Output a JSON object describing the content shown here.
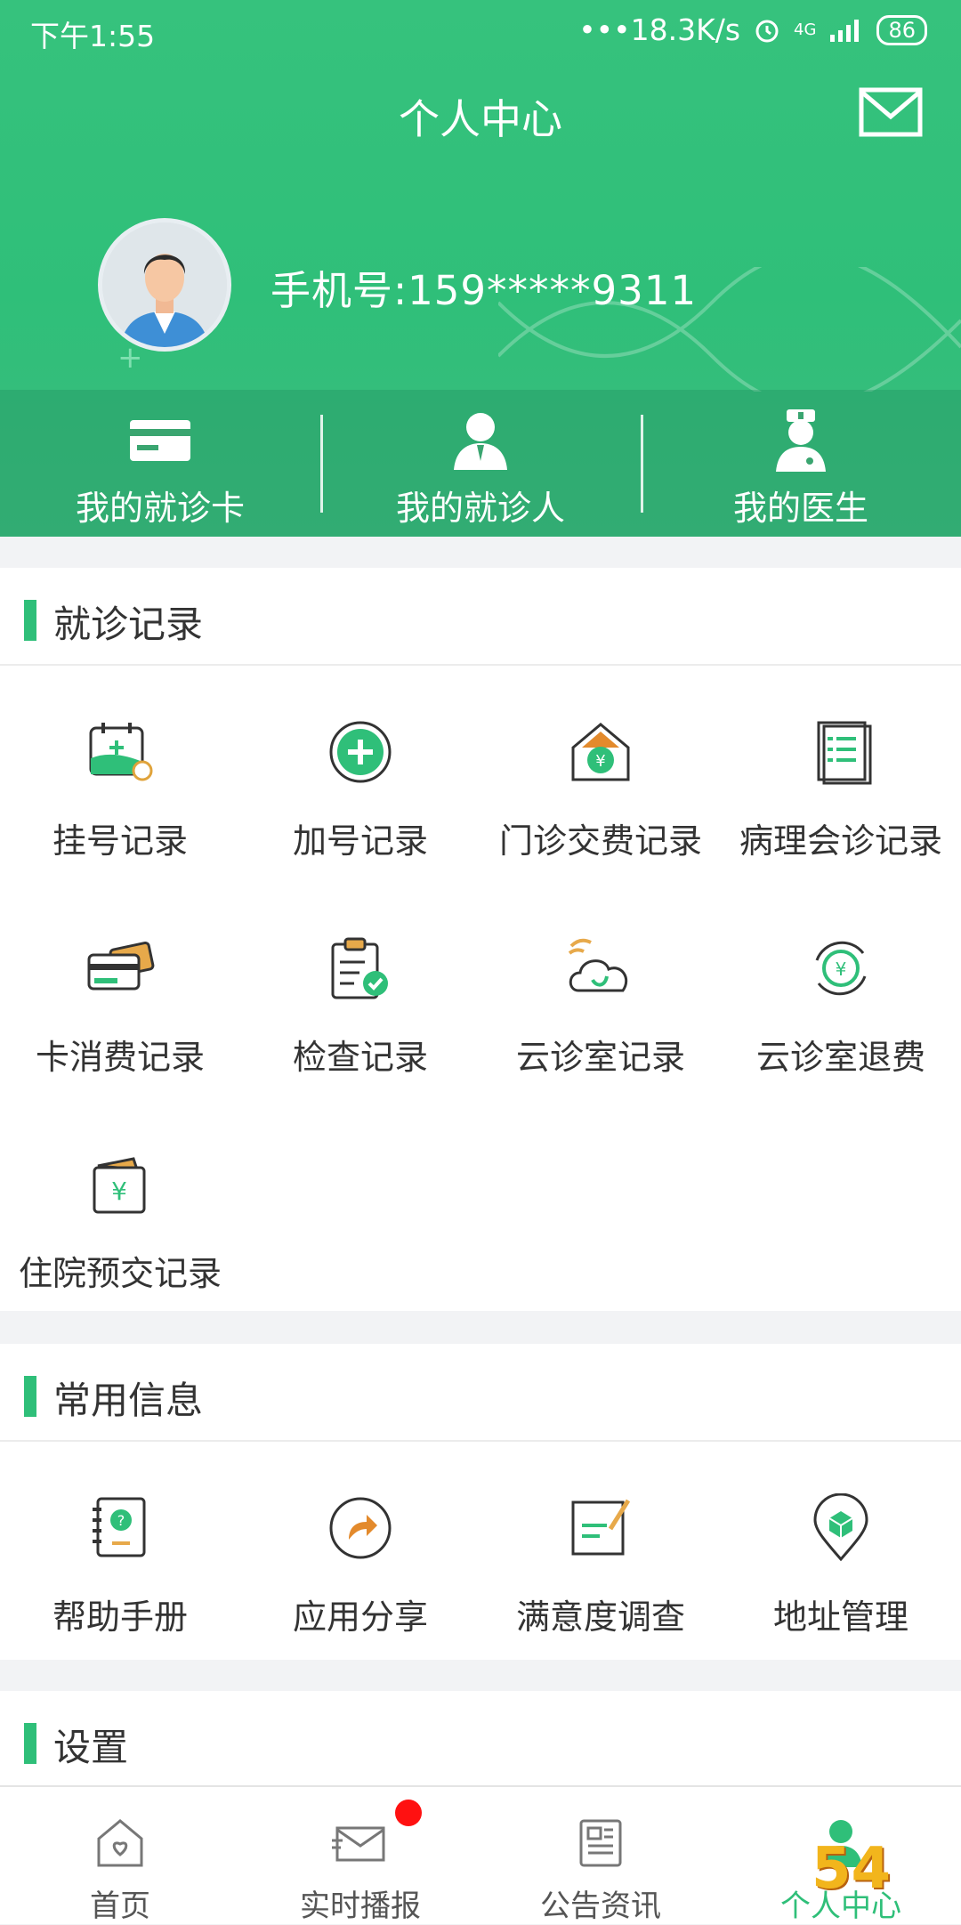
{
  "status_bar": {
    "time": "下午1:55",
    "speed": "•••18.3K/s",
    "network": "4G",
    "battery": "86"
  },
  "header": {
    "title": "个人中心",
    "phone": "手机号:159*****9311"
  },
  "shortcuts": [
    {
      "label": "我的就诊卡",
      "icon": "card-icon"
    },
    {
      "label": "我的就诊人",
      "icon": "patient-icon"
    },
    {
      "label": "我的医生",
      "icon": "doctor-icon"
    }
  ],
  "records": {
    "title": "就诊记录",
    "items": [
      {
        "label": "挂号记录",
        "icon": "calendar-plus-icon"
      },
      {
        "label": "加号记录",
        "icon": "plus-circle-icon"
      },
      {
        "label": "门诊交费记录",
        "icon": "yen-house-icon"
      },
      {
        "label": "病理会诊记录",
        "icon": "document-list-icon"
      },
      {
        "label": "卡消费记录",
        "icon": "cards-icon"
      },
      {
        "label": "检查记录",
        "icon": "clipboard-check-icon"
      },
      {
        "label": "云诊室记录",
        "icon": "cloud-stethoscope-icon"
      },
      {
        "label": "云诊室退费",
        "icon": "yen-refresh-icon"
      },
      {
        "label": "住院预交记录",
        "icon": "yen-wallet-icon"
      }
    ]
  },
  "common": {
    "title": "常用信息",
    "items": [
      {
        "label": "帮助手册",
        "icon": "help-book-icon"
      },
      {
        "label": "应用分享",
        "icon": "share-icon"
      },
      {
        "label": "满意度调查",
        "icon": "survey-icon"
      },
      {
        "label": "地址管理",
        "icon": "location-icon"
      }
    ]
  },
  "settings": {
    "title": "设置"
  },
  "tabbar": [
    {
      "label": "首页",
      "icon": "home-icon"
    },
    {
      "label": "实时播报",
      "icon": "broadcast-icon"
    },
    {
      "label": "公告资讯",
      "icon": "news-icon"
    },
    {
      "label": "个人中心",
      "icon": "person-icon"
    }
  ],
  "watermark": "54"
}
